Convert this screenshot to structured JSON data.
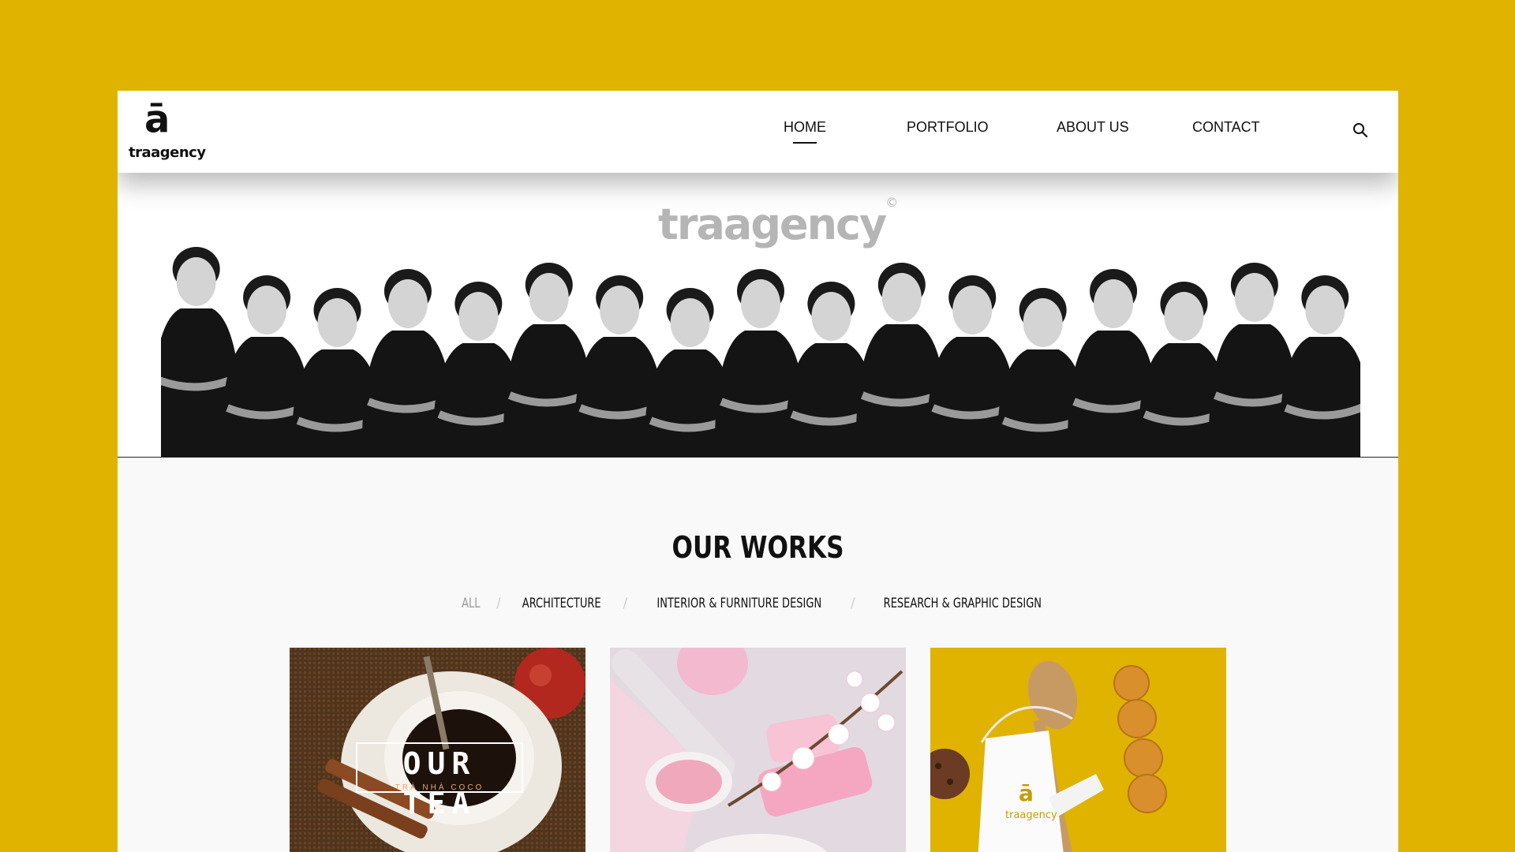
{
  "brand": {
    "logo_glyph": "ā",
    "logo_word": "traagency",
    "hero_word": "traagency",
    "hero_mark": "©"
  },
  "nav": {
    "items": [
      {
        "label": "HOME",
        "active": true
      },
      {
        "label": "PORTFOLIO",
        "active": false
      },
      {
        "label": "ABOUT US",
        "active": false
      },
      {
        "label": "CONTACT",
        "active": false
      }
    ],
    "search_icon": "search-icon"
  },
  "works": {
    "title": "OUR WORKS",
    "filters": [
      "ALL",
      "ARCHITECTURE",
      "INTERIOR & FURNITURE DESIGN",
      "RESEARCH & GRAPHIC DESIGN"
    ],
    "separator": "/",
    "cards": [
      {
        "title": "OUR TEA",
        "subtitle": "TRÀ NHÀ COCO"
      },
      {
        "title": ""
      },
      {
        "glyph": "ā",
        "label": "traagency"
      }
    ]
  },
  "colors": {
    "background": "#e0b300",
    "accent": "#e0b300"
  }
}
